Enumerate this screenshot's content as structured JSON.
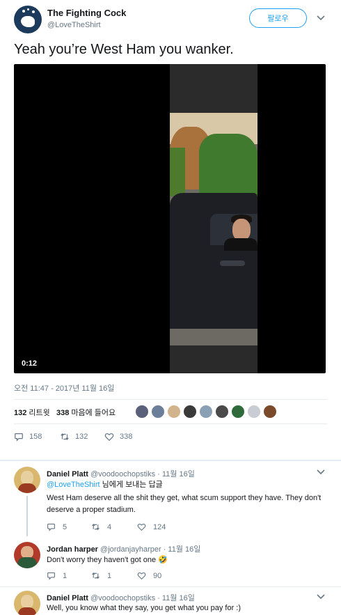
{
  "header": {
    "display_name": "The Fighting Cock",
    "handle": "@LoveTheShirt",
    "follow_label": "팔로우",
    "menu_icon": "chevron-down-icon"
  },
  "tweet": {
    "text": "Yeah you’re West Ham you wanker.",
    "video_duration": "0:12",
    "timestamp": "오전 11:47 - 2017년 11월 16일",
    "retweet_count": "132",
    "retweet_label": "리트윗",
    "like_count": "338",
    "like_label": "마음에 들어요",
    "actions": {
      "replies": "158",
      "retweets": "132",
      "likes": "338"
    }
  },
  "likers": {
    "count_shown": 9,
    "colors": [
      "#5a5f7a",
      "#6c7f9a",
      "#d2b48c",
      "#3a3a3a",
      "#8aa0b5",
      "#4a4a4a",
      "#2f6a3a",
      "#c9ccd2",
      "#7a4a2a"
    ]
  },
  "replies": [
    {
      "name": "Daniel Platt",
      "handle": "@voodoochopstiks",
      "time": "· 11월 16일",
      "reply_to_mention": "@LoveTheShirt",
      "reply_to_suffix": " 님에게 보내는 답글",
      "text": "West Ham deserve all the shit they get, what scum support they have. They don't deserve a proper stadium.",
      "replies": "5",
      "retweets": "4",
      "likes": "124"
    },
    {
      "name": "Jordan harper",
      "handle": "@jordanjayharper",
      "time": "· 11월 16일",
      "text": "Don't worry they haven't got one 🤣",
      "replies": "1",
      "retweets": "1",
      "likes": "90"
    },
    {
      "name": "Daniel Platt",
      "handle": "@voodoochopstiks",
      "time": "· 11월 16일",
      "text": "Well, you know what they say, you get what you pay for :)"
    }
  ],
  "colors": {
    "accent": "#1da1f2",
    "muted": "#657786",
    "text": "#14171a"
  }
}
